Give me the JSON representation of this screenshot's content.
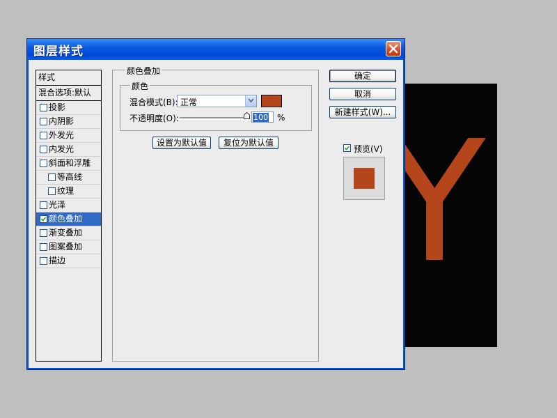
{
  "canvas": {
    "letter": "Y",
    "letter_color": "#b5451a",
    "background": "#050505"
  },
  "dialog": {
    "title": "图层样式",
    "close_icon": "close-icon"
  },
  "styles": {
    "header": "样式",
    "blend_options": "混合选项:默认",
    "items": [
      {
        "label": "投影",
        "checked": false,
        "indent": false
      },
      {
        "label": "内阴影",
        "checked": false,
        "indent": false
      },
      {
        "label": "外发光",
        "checked": false,
        "indent": false
      },
      {
        "label": "内发光",
        "checked": false,
        "indent": false
      },
      {
        "label": "斜面和浮雕",
        "checked": false,
        "indent": false
      },
      {
        "label": "等高线",
        "checked": false,
        "indent": true
      },
      {
        "label": "纹理",
        "checked": false,
        "indent": true
      },
      {
        "label": "光泽",
        "checked": false,
        "indent": false
      },
      {
        "label": "颜色叠加",
        "checked": true,
        "indent": false,
        "selected": true
      },
      {
        "label": "渐变叠加",
        "checked": false,
        "indent": false
      },
      {
        "label": "图案叠加",
        "checked": false,
        "indent": false
      },
      {
        "label": "描边",
        "checked": false,
        "indent": false
      }
    ]
  },
  "color_overlay": {
    "group_title": "颜色叠加",
    "subgroup_title": "颜色",
    "blend_mode_label": "混合模式(B):",
    "blend_mode_value": "正常",
    "swatch_color": "#b5451a",
    "opacity_label": "不透明度(O):",
    "opacity_value": "100",
    "opacity_unit": "%",
    "opacity_level": 1.0,
    "set_default_button": "设置为默认值",
    "reset_default_button": "复位为默认值"
  },
  "actions": {
    "ok": "确定",
    "cancel": "取消",
    "new_style": "新建样式(W)...",
    "preview_label": "预览(V)",
    "preview_checked": true,
    "preview_color": "#b5451a"
  }
}
